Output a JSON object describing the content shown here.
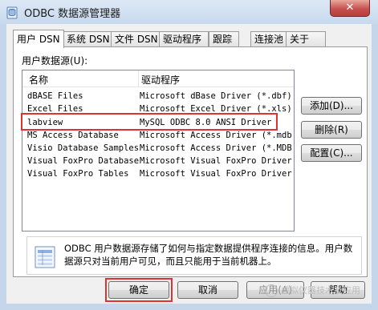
{
  "window": {
    "title": "ODBC 数据源管理器",
    "close_label": "✕"
  },
  "tabs": [
    {
      "label": "用户 DSN"
    },
    {
      "label": "系统 DSN"
    },
    {
      "label": "文件 DSN"
    },
    {
      "label": "驱动程序"
    },
    {
      "label": "跟踪"
    },
    {
      "label": "连接池"
    },
    {
      "label": "关于"
    }
  ],
  "user_dsn": {
    "group_label": "用户数据源(U):",
    "columns": {
      "name": "名称",
      "driver": "驱动程序"
    },
    "rows": [
      {
        "name": "dBASE Files",
        "driver": "Microsoft dBase Driver (*.dbf)"
      },
      {
        "name": "Excel Files",
        "driver": "Microsoft Excel Driver (*.xls)"
      },
      {
        "name": "labview",
        "driver": "MySQL ODBC 8.0 ANSI Driver"
      },
      {
        "name": "MS Access Database",
        "driver": "Microsoft Access Driver (*.mdb"
      },
      {
        "name": "Visio Database Samples",
        "driver": "Microsoft Access Driver (*.MDB"
      },
      {
        "name": "Visual FoxPro Database",
        "driver": "Microsoft Visual FoxPro Driver"
      },
      {
        "name": "Visual FoxPro Tables",
        "driver": "Microsoft Visual FoxPro Driver"
      }
    ],
    "buttons": {
      "add": "添加(D)...",
      "remove": "删除(R)",
      "configure": "配置(C)..."
    },
    "info_text": "ODBC 用户数据源存储了如何与指定数据提供程序连接的信息。用户数据源只对当前用户可见，而且只能用于当前机器上。"
  },
  "footer": {
    "ok": "确定",
    "cancel": "取消",
    "apply": "应用(A)",
    "help": "帮助",
    "watermark": "虚拟仪器技术及应用"
  },
  "colors": {
    "highlight_box": "#e03232",
    "close_button": "#c75050"
  }
}
